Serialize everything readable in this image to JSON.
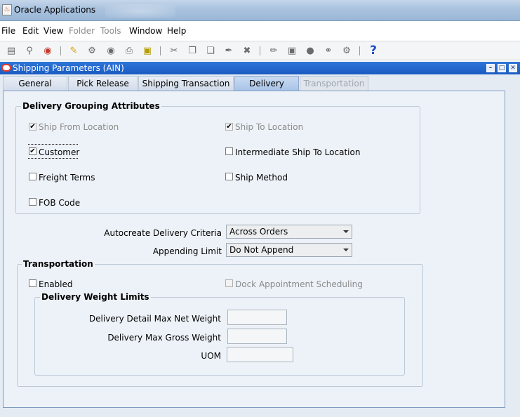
{
  "window": {
    "title": "Oracle Applications"
  },
  "menu": [
    "File",
    "Edit",
    "View",
    "Folder",
    "Tools",
    "Window",
    "Help"
  ],
  "toolbar": {
    "icons": [
      "new-icon",
      "find-icon",
      "navigator-icon",
      "save-icon",
      "next-step-icon",
      "switch-responsibility-icon",
      "print-icon",
      "close-form-icon",
      "cut-icon",
      "copy-icon",
      "paste-icon",
      "clear-record-icon",
      "delete-icon",
      "edit-field-icon",
      "zoom-icon",
      "translations-icon",
      "attachments-icon",
      "folder-tools-icon",
      "help-icon"
    ]
  },
  "form": {
    "title": "Shipping Parameters (AIN)"
  },
  "tabs": [
    "General",
    "Pick Release",
    "Shipping Transaction",
    "Delivery",
    "Transportation"
  ],
  "delivery_grouping": {
    "title": "Delivery Grouping Attributes",
    "items": [
      {
        "label": "Ship From Location",
        "checked": true,
        "enabled": false
      },
      {
        "label": "Ship To Location",
        "checked": true,
        "enabled": false
      },
      {
        "label": "Customer",
        "checked": true,
        "enabled": true
      },
      {
        "label": "Intermediate Ship To Location",
        "checked": false,
        "enabled": true
      },
      {
        "label": "Freight Terms",
        "checked": false,
        "enabled": true
      },
      {
        "label": "Ship Method",
        "checked": false,
        "enabled": true
      },
      {
        "label": "FOB Code",
        "checked": false,
        "enabled": true
      }
    ]
  },
  "autocreate": {
    "label": "Autocreate Delivery Criteria",
    "value": "Across Orders"
  },
  "appending": {
    "label": "Appending Limit",
    "value": "Do Not Append"
  },
  "transportation": {
    "title": "Transportation",
    "enabled_label": "Enabled",
    "dock_label": "Dock Appointment Scheduling"
  },
  "weight_limits": {
    "title": "Delivery Weight Limits",
    "detail_max_net": {
      "label": "Delivery Detail Max Net Weight",
      "value": ""
    },
    "max_gross": {
      "label": "Delivery Max Gross Weight",
      "value": ""
    },
    "uom": {
      "label": "UOM",
      "value": ""
    }
  }
}
